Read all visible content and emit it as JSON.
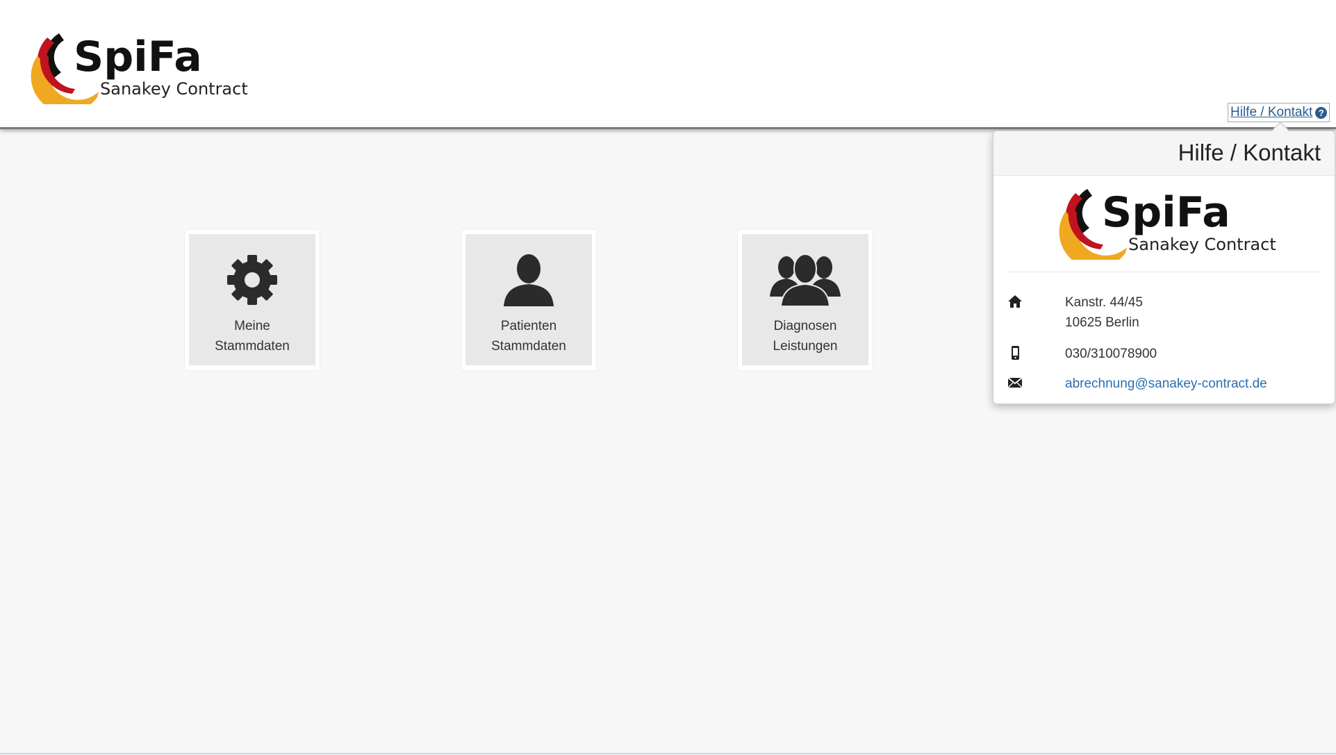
{
  "brand": {
    "name": "SpiFa",
    "subtitle": "Sanakey Contract",
    "colors": {
      "red": "#c1121f",
      "black": "#111111",
      "orange": "#f0a820"
    }
  },
  "header": {
    "help_link": "Hilfe / Kontakt",
    "help_icon": "question-circle-icon"
  },
  "tiles": [
    {
      "line1": "Meine",
      "line2": "Stammdaten",
      "icon": "gear-icon"
    },
    {
      "line1": "Patienten",
      "line2": "Stammdaten",
      "icon": "user-icon"
    },
    {
      "line1": "Diagnosen",
      "line2": "Leistungen",
      "icon": "users-group-icon"
    }
  ],
  "popover": {
    "title": "Hilfe / Kontakt",
    "address_line1": "Kanstr. 44/45",
    "address_line2": "10625 Berlin",
    "phone": "030/310078900",
    "email": "abrechnung@sanakey-contract.de",
    "icons": [
      "home-icon",
      "mobile-phone-icon",
      "envelope-icon"
    ]
  },
  "colors": {
    "link": "#2a6eb0",
    "tile_bg": "#e8e8e8",
    "page_bg": "#f7f7f7"
  }
}
